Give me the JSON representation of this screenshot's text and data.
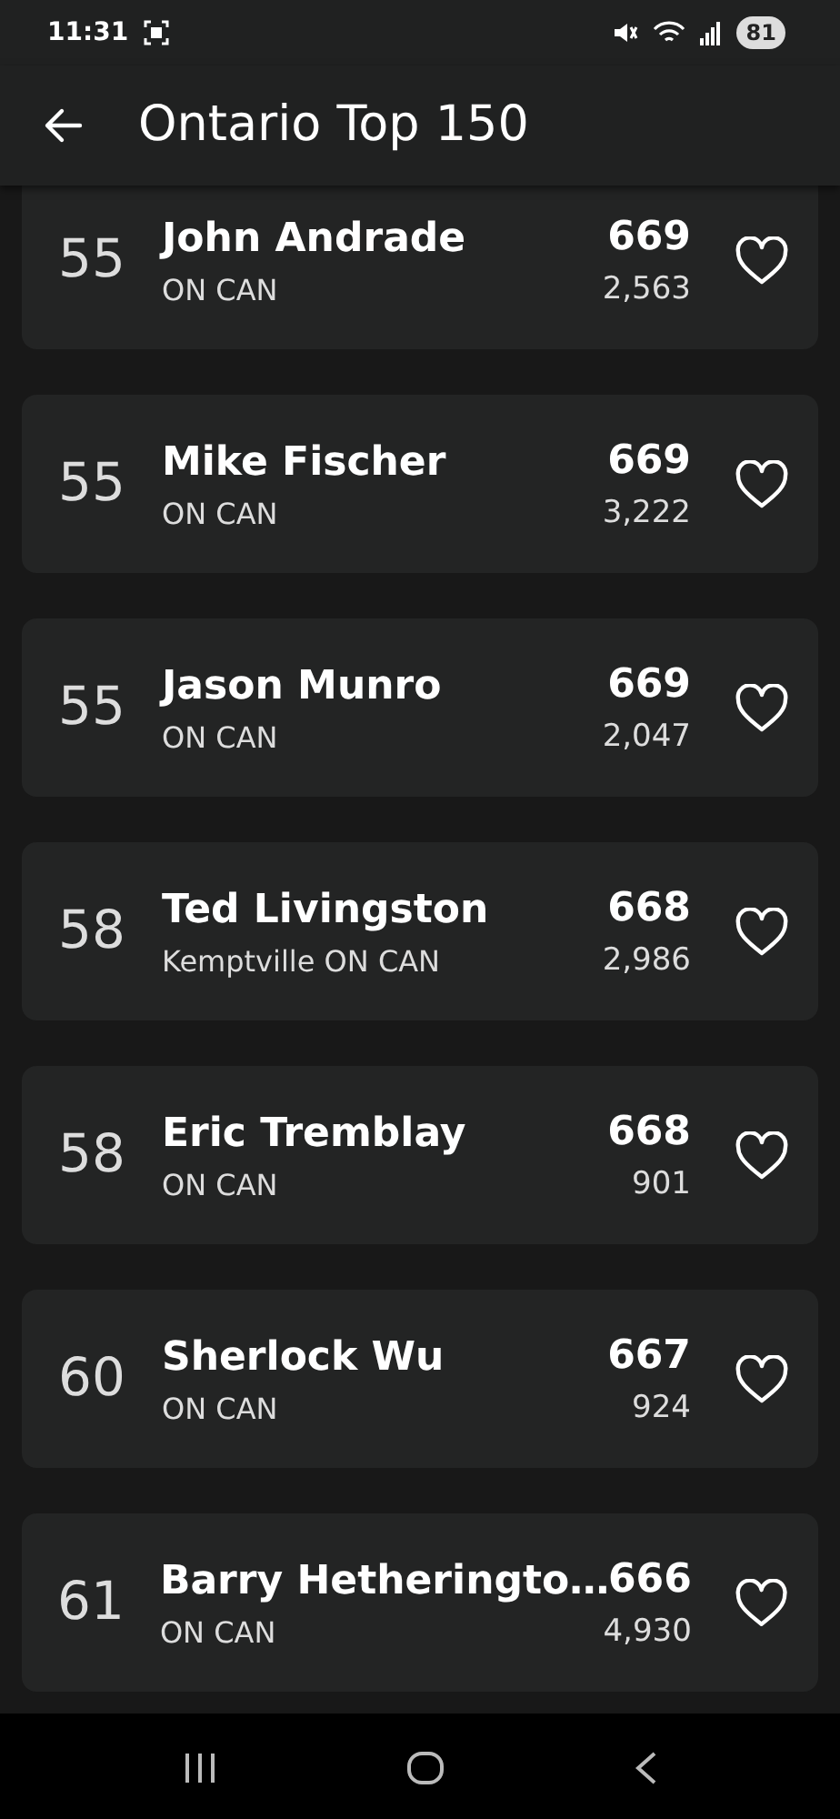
{
  "status_bar": {
    "time": "11:31",
    "battery": "81"
  },
  "app_bar": {
    "title": "Ontario Top 150"
  },
  "players": [
    {
      "rank": "55",
      "name": "John Andrade",
      "location": "ON CAN",
      "rating": "669",
      "count": "2,563",
      "favorite": false
    },
    {
      "rank": "55",
      "name": "Mike Fischer",
      "location": "ON CAN",
      "rating": "669",
      "count": "3,222",
      "favorite": false
    },
    {
      "rank": "55",
      "name": "Jason Munro",
      "location": "ON CAN",
      "rating": "669",
      "count": "2,047",
      "favorite": false
    },
    {
      "rank": "58",
      "name": "Ted Livingston",
      "location": "Kemptville ON CAN",
      "rating": "668",
      "count": "2,986",
      "favorite": false
    },
    {
      "rank": "58",
      "name": "Eric Tremblay",
      "location": "ON CAN",
      "rating": "668",
      "count": "901",
      "favorite": false
    },
    {
      "rank": "60",
      "name": "Sherlock Wu",
      "location": "ON CAN",
      "rating": "667",
      "count": "924",
      "favorite": false
    },
    {
      "rank": "61",
      "name": "Barry Hetheringto…",
      "location": "ON CAN",
      "rating": "666",
      "count": "4,930",
      "favorite": false
    }
  ]
}
